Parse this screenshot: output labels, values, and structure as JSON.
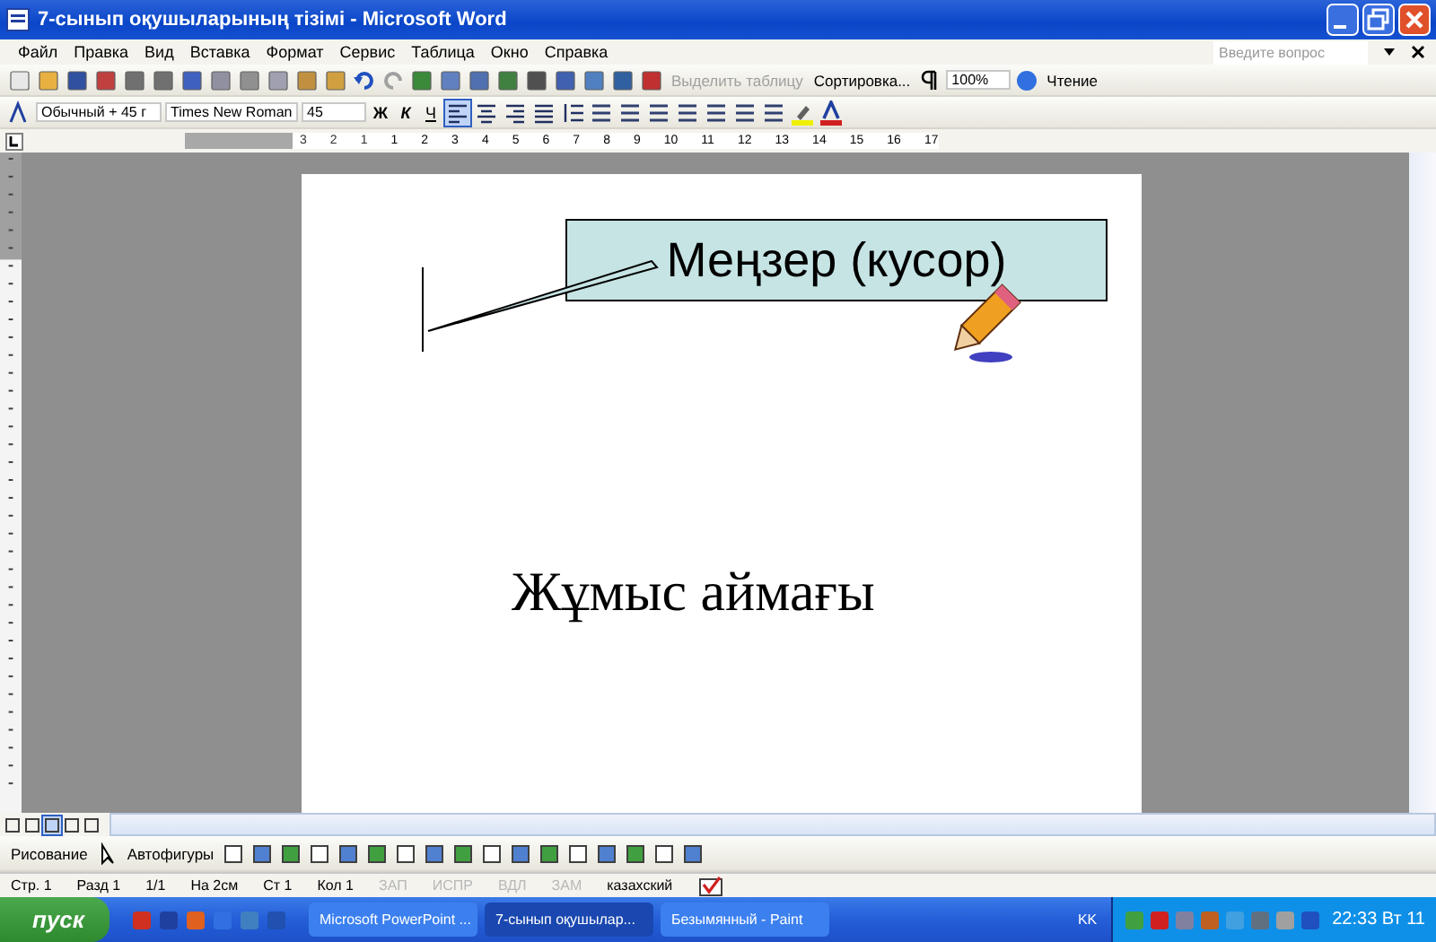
{
  "window": {
    "title": "7-сынып оқушыларының тізімі - Microsoft Word"
  },
  "menu": [
    "Файл",
    "Правка",
    "Вид",
    "Вставка",
    "Формат",
    "Сервис",
    "Таблица",
    "Окно",
    "Справка"
  ],
  "help_search": {
    "placeholder": "Введите вопрос"
  },
  "standard_toolbar": {
    "select_table": "Выделить таблицу",
    "sort": "Сортировка...",
    "zoom": "100%",
    "reading": "Чтение"
  },
  "formatting_toolbar": {
    "style": "Обычный + 45 г",
    "font": "Times New Roman",
    "size": "45",
    "bold": "Ж",
    "italic": "К",
    "underline": "Ч",
    "align_buttons": [
      {
        "selected": true
      },
      {
        "selected": false
      },
      {
        "selected": false
      },
      {
        "selected": false
      }
    ]
  },
  "ruler": [
    "3",
    "2",
    "1",
    "1",
    "2",
    "3",
    "4",
    "5",
    "6",
    "7",
    "8",
    "9",
    "10",
    "11",
    "12",
    "13",
    "14",
    "15",
    "16",
    "17"
  ],
  "document": {
    "callout": "Меңзер (кусор)",
    "body": "Жұмыс аймағы"
  },
  "view_buttons": [
    {
      "selected": false
    },
    {
      "selected": false
    },
    {
      "selected": true
    },
    {
      "selected": false
    },
    {
      "selected": false
    }
  ],
  "drawing_toolbar": {
    "draw": "Рисование",
    "autoshapes": "Автофигуры"
  },
  "status_bar": {
    "fields": [
      "Стр. 1",
      "Разд 1",
      "1/1",
      "На 2см",
      "Ст 1",
      "Кол 1"
    ],
    "modes": [
      {
        "label": "ЗАП",
        "disabled": true
      },
      {
        "label": "ИСПР",
        "disabled": true
      },
      {
        "label": "ВДЛ",
        "disabled": true
      },
      {
        "label": "ЗАМ",
        "disabled": true
      }
    ],
    "language": "казахский"
  },
  "taskbar": {
    "start": "пуск",
    "tasks": [
      {
        "label": "Microsoft PowerPoint ...",
        "selected": false
      },
      {
        "label": "7-сынып оқушылар...",
        "selected": true
      },
      {
        "label": "Безымянный - Paint",
        "selected": false
      }
    ],
    "language": "KK",
    "clock": "22:33 Вт 11"
  }
}
